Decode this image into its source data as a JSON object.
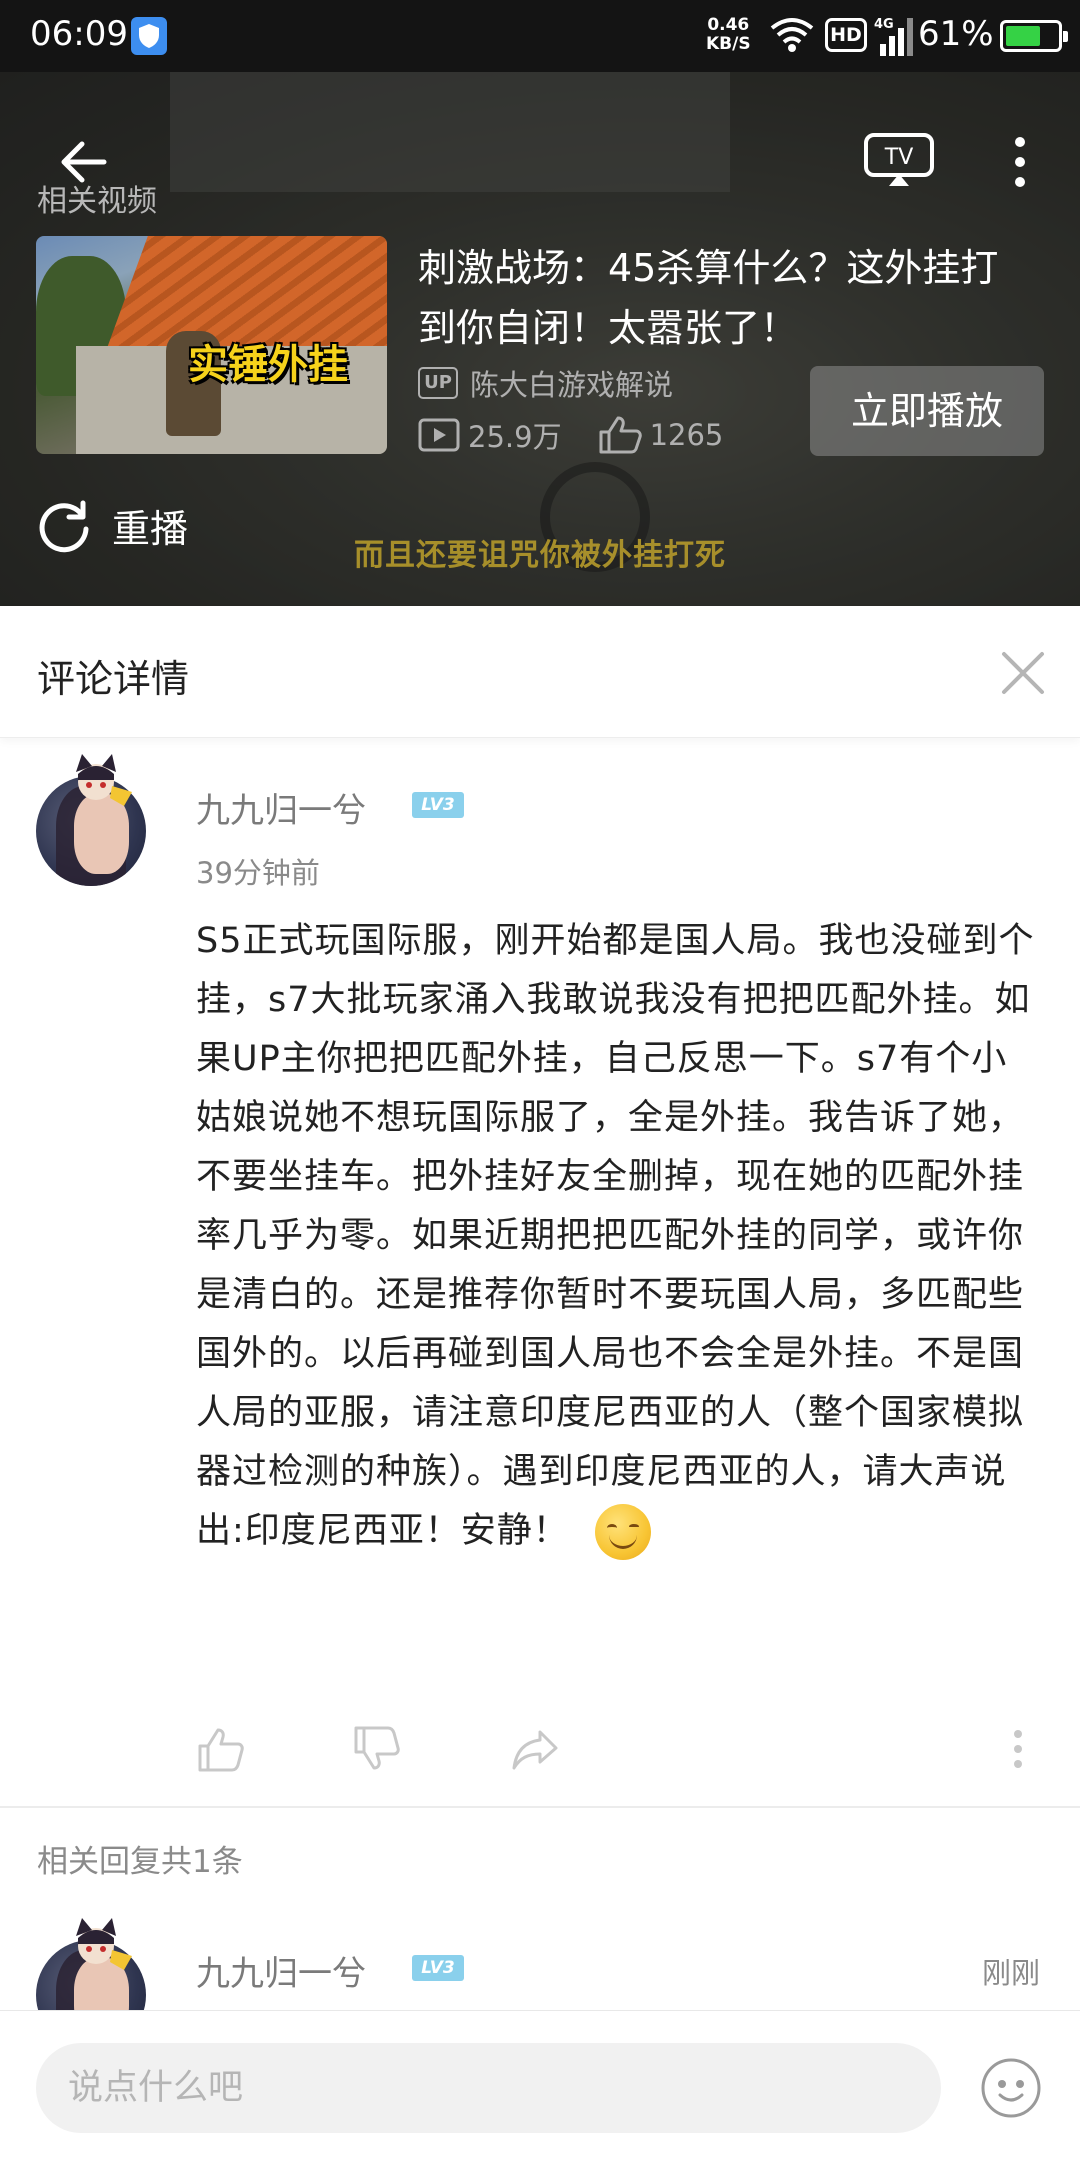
{
  "status_bar": {
    "time": "06:09",
    "net_speed_value": "0.46",
    "net_speed_unit": "KB/S",
    "hd_label": "HD",
    "signal_type": "4G",
    "battery_percent": "61%",
    "battery_level": 0.61
  },
  "video": {
    "related_label": "相关视频",
    "subtitle": "而且还要诅咒你被外挂打死",
    "thumbnail_text": "实锤外挂",
    "title": "刺激战场：45杀算什么？这外挂打到你自闭！太嚣张了！",
    "up_badge": "UP",
    "uploader": "陈大白游戏解说",
    "views": "25.9万",
    "likes": "1265",
    "play_now_label": "立即播放",
    "replay_label": "重播",
    "tv_label": "TV"
  },
  "comment_detail": {
    "title": "评论详情"
  },
  "comment": {
    "username": "九九归一兮",
    "level": "LV3",
    "time": "39分钟前",
    "body": "S5正式玩国际服，刚开始都是国人局。我也没碰到个挂，s7大批玩家涌入我敢说我没有把把匹配外挂。如果UP主你把把匹配外挂，自己反思一下。s7有个小姑娘说她不想玩国际服了，全是外挂。我告诉了她，不要坐挂车。把外挂好友全删掉，现在她的匹配外挂率几乎为零。如果近期把把匹配外挂的同学，或许你是清白的。还是推荐你暂时不要玩国人局，多匹配些国外的。以后再碰到国人局也不会全是外挂。不是国人局的亚服，请注意印度尼西亚的人（整个国家模拟器过检测的种族）。遇到印度尼西亚的人，请大声说出:印度尼西亚！安静！"
  },
  "replies": {
    "header": "相关回复共1条",
    "items": [
      {
        "username": "九九归一兮",
        "level": "LV3",
        "time": "刚刚"
      }
    ]
  },
  "input": {
    "placeholder": "说点什么吧"
  }
}
